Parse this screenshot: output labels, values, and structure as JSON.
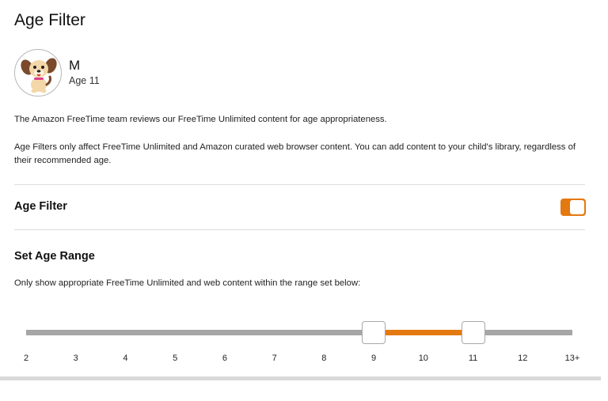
{
  "page": {
    "title": "Age Filter"
  },
  "profile": {
    "name": "M",
    "age": "Age 11",
    "avatar_icon": "puppy-avatar-icon"
  },
  "descriptions": {
    "line1": "The Amazon FreeTime team reviews our FreeTime Unlimited content for age appropriateness.",
    "line2": "Age Filters only affect FreeTime Unlimited and Amazon curated web browser content. You can add content to your child's library, regardless of their recommended age."
  },
  "age_filter": {
    "label": "Age Filter",
    "enabled": true
  },
  "age_range": {
    "label": "Set Age Range",
    "description": "Only show appropriate FreeTime Unlimited and web content within the range set below:",
    "ticks": [
      "2",
      "3",
      "4",
      "5",
      "6",
      "7",
      "8",
      "9",
      "10",
      "11",
      "12",
      "13+"
    ],
    "min_selected": "9",
    "max_selected": "11"
  },
  "colors": {
    "accent": "#e47911",
    "track": "#a6a6a6",
    "divider": "#dddddd"
  }
}
